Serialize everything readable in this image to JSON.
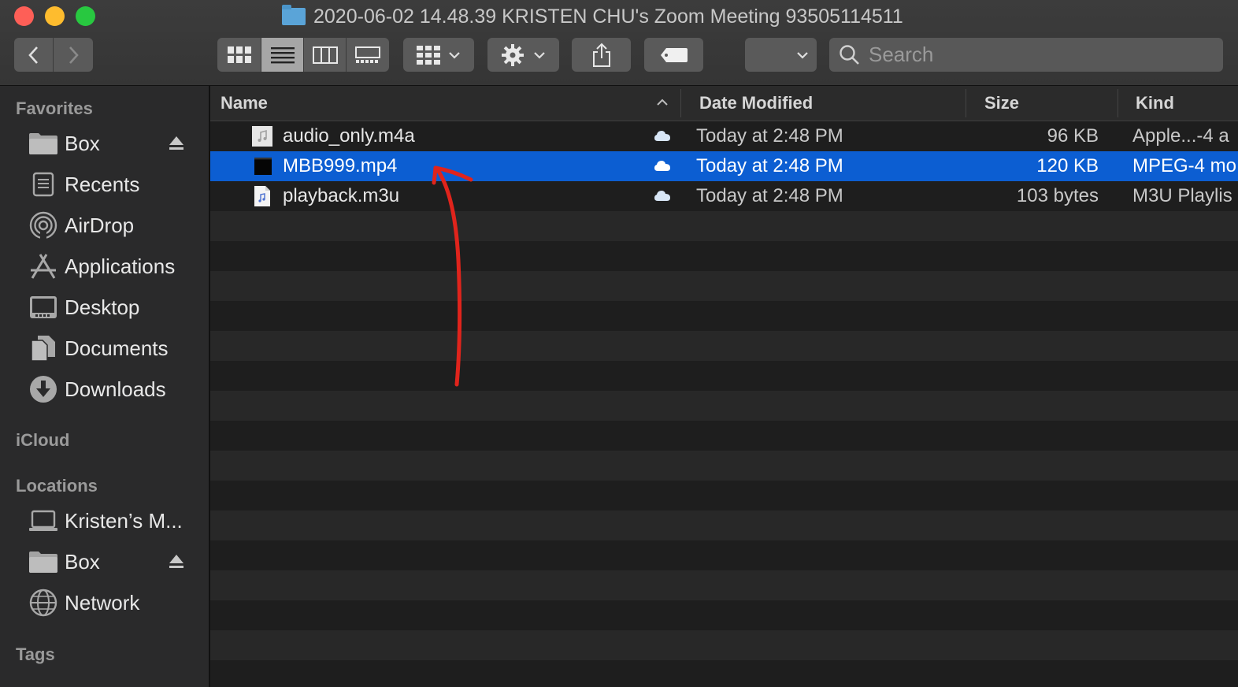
{
  "window": {
    "title": "2020-06-02 14.48.39 KRISTEN CHU's Zoom Meeting 93505114511"
  },
  "toolbar": {
    "back_icon": "chevron-left-icon",
    "forward_icon": "chevron-right-icon",
    "views": [
      "icon-view",
      "list-view",
      "column-view",
      "gallery-view"
    ],
    "active_view": "list-view",
    "search_placeholder": "Search"
  },
  "sidebar": {
    "favorites_header": "Favorites",
    "favorites": [
      {
        "label": "Box",
        "icon": "folder-icon",
        "eject": true
      },
      {
        "label": "Recents",
        "icon": "recents-icon"
      },
      {
        "label": "AirDrop",
        "icon": "airdrop-icon"
      },
      {
        "label": "Applications",
        "icon": "applications-icon"
      },
      {
        "label": "Desktop",
        "icon": "desktop-icon"
      },
      {
        "label": "Documents",
        "icon": "documents-icon"
      },
      {
        "label": "Downloads",
        "icon": "downloads-icon"
      }
    ],
    "icloud_header": "iCloud",
    "locations_header": "Locations",
    "locations": [
      {
        "label": "Kristen’s M...",
        "icon": "laptop-icon"
      },
      {
        "label": "Box",
        "icon": "folder-icon",
        "eject": true
      },
      {
        "label": "Network",
        "icon": "network-icon"
      }
    ],
    "tags_header": "Tags"
  },
  "table": {
    "columns": {
      "name": "Name",
      "date": "Date Modified",
      "size": "Size",
      "kind": "Kind"
    },
    "rows": [
      {
        "name": "audio_only.m4a",
        "date": "Today at 2:48 PM",
        "size": "96 KB",
        "kind": "Apple...-4 a",
        "selected": false
      },
      {
        "name": "MBB999.mp4",
        "date": "Today at 2:48 PM",
        "size": "120 KB",
        "kind": "MPEG-4 mo",
        "selected": true
      },
      {
        "name": "playback.m3u",
        "date": "Today at 2:48 PM",
        "size": "103 bytes",
        "kind": "M3U Playlis",
        "selected": false
      }
    ]
  },
  "colors": {
    "selection": "#0c5ed2",
    "annotation_arrow": "#e0241c"
  }
}
